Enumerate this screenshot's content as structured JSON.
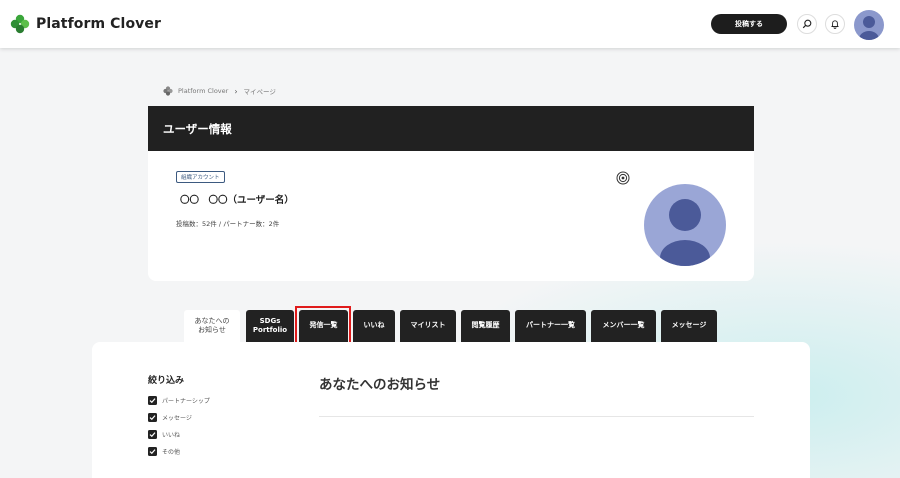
{
  "header": {
    "app_name": "Platform Clover",
    "post_button_label": "投稿する",
    "icons": [
      "clover-logo-icon",
      "search-icon",
      "bell-icon",
      "avatar-icon"
    ]
  },
  "breadcrumb": {
    "home": "Platform Clover",
    "separator": "›",
    "current": "マイページ"
  },
  "user_panel": {
    "title": "ユーザー情報",
    "badge": "組織アカウント",
    "name": "〇〇　〇〇（ユーザー名）",
    "stats": "投稿数：52件 / パートナー数：2件"
  },
  "tabs": [
    {
      "label": "あなたへの\nお知らせ",
      "active": true
    },
    {
      "label": "SDGs\nPortfolio",
      "active": false
    },
    {
      "label": "発信一覧",
      "active": false,
      "highlighted": true
    },
    {
      "label": "いいね",
      "active": false
    },
    {
      "label": "マイリスト",
      "active": false
    },
    {
      "label": "閲覧履歴",
      "active": false
    },
    {
      "label": "パートナー一覧",
      "active": false
    },
    {
      "label": "メンバー一覧",
      "active": false
    },
    {
      "label": "メッセージ",
      "active": false
    }
  ],
  "filter": {
    "title": "絞り込み",
    "items": [
      {
        "label": "パートナーシップ",
        "checked": true
      },
      {
        "label": "メッセージ",
        "checked": true
      },
      {
        "label": "いいね",
        "checked": true
      },
      {
        "label": "その他",
        "checked": true
      }
    ]
  },
  "main": {
    "section_title": "あなたへのお知らせ"
  },
  "colors": {
    "dark": "#212121",
    "highlight": "#e01b1b",
    "avatar": "#9aa6d6",
    "brand_green": "#3aa63a"
  }
}
